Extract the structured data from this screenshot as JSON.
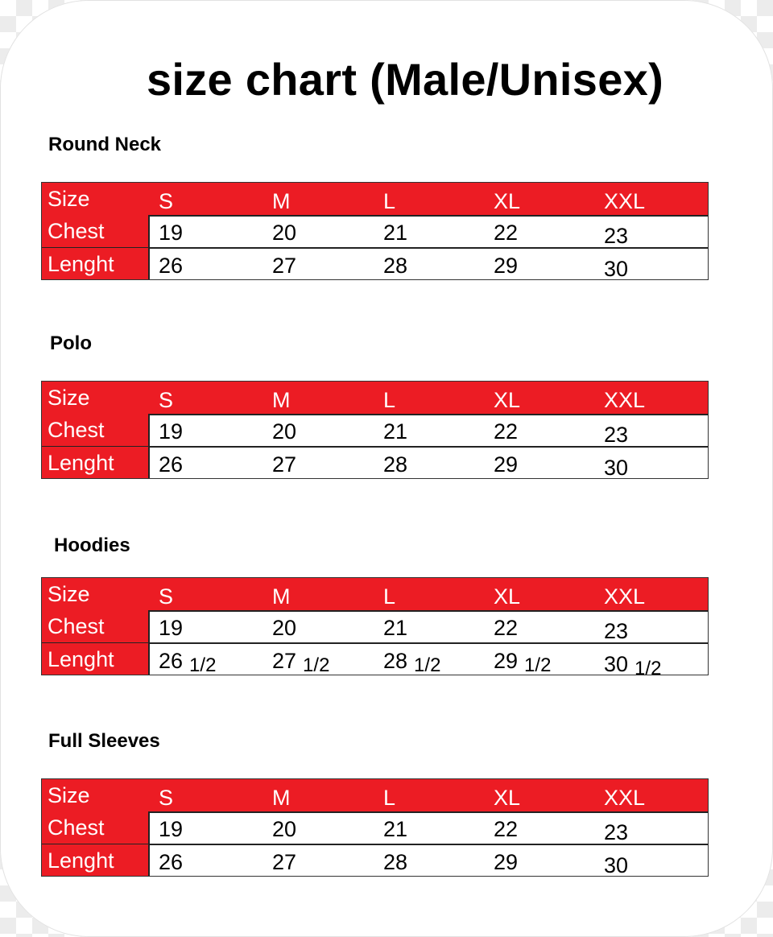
{
  "title": "size chart (Male/Unisex)",
  "labels": {
    "size": "Size",
    "chest": "Chest",
    "length": "Lenght"
  },
  "sizes": [
    "S",
    "M",
    "L",
    "XL",
    "XXL"
  ],
  "colors": {
    "header_red": "#ec1c24",
    "text": "#000000",
    "header_text": "#ffffff"
  },
  "sections": [
    {
      "heading": "Round Neck",
      "chest": [
        "19",
        "20",
        "21",
        "22",
        "23"
      ],
      "length": [
        {
          "whole": "26",
          "fraction": ""
        },
        {
          "whole": "27",
          "fraction": ""
        },
        {
          "whole": "28",
          "fraction": ""
        },
        {
          "whole": "29",
          "fraction": ""
        },
        {
          "whole": "30",
          "fraction": ""
        }
      ]
    },
    {
      "heading": "Polo",
      "chest": [
        "19",
        "20",
        "21",
        "22",
        "23"
      ],
      "length": [
        {
          "whole": "26",
          "fraction": ""
        },
        {
          "whole": "27",
          "fraction": ""
        },
        {
          "whole": "28",
          "fraction": ""
        },
        {
          "whole": "29",
          "fraction": ""
        },
        {
          "whole": "30",
          "fraction": ""
        }
      ]
    },
    {
      "heading": "Hoodies",
      "chest": [
        "19",
        "20",
        "21",
        "22",
        "23"
      ],
      "length": [
        {
          "whole": "26",
          "fraction": "1/2"
        },
        {
          "whole": "27",
          "fraction": "1/2"
        },
        {
          "whole": "28",
          "fraction": "1/2"
        },
        {
          "whole": "29",
          "fraction": "1/2"
        },
        {
          "whole": "30",
          "fraction": "1/2"
        }
      ]
    },
    {
      "heading": "Full Sleeves",
      "chest": [
        "19",
        "20",
        "21",
        "22",
        "23"
      ],
      "length": [
        {
          "whole": "26",
          "fraction": ""
        },
        {
          "whole": "27",
          "fraction": ""
        },
        {
          "whole": "28",
          "fraction": ""
        },
        {
          "whole": "29",
          "fraction": ""
        },
        {
          "whole": "30",
          "fraction": ""
        }
      ]
    }
  ]
}
